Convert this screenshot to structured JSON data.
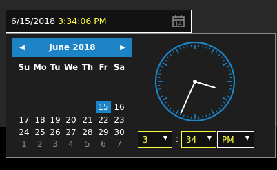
{
  "input": {
    "date": "6/15/2018",
    "time": "3:34:06 PM"
  },
  "calendar": {
    "title": "June 2018",
    "weekdays": [
      "Su",
      "Mo",
      "Tu",
      "We",
      "Th",
      "Fr",
      "Sa"
    ],
    "weeks": [
      [
        "",
        "",
        "",
        "",
        "",
        "15",
        "16"
      ],
      [
        "17",
        "18",
        "19",
        "20",
        "21",
        "22",
        "23"
      ],
      [
        "24",
        "25",
        "26",
        "27",
        "28",
        "29",
        "30"
      ],
      [
        "1",
        "2",
        "3",
        "4",
        "5",
        "6",
        "7"
      ]
    ],
    "selected_day": "15"
  },
  "clock": {
    "hour": 3,
    "minute": 34,
    "color": "#1c84c6"
  },
  "time_selector": {
    "hour": "3",
    "separator": ":",
    "minute": "34",
    "ampm": "PM"
  },
  "colors": {
    "accent": "#1c84c6",
    "highlight": "#ffff40"
  }
}
